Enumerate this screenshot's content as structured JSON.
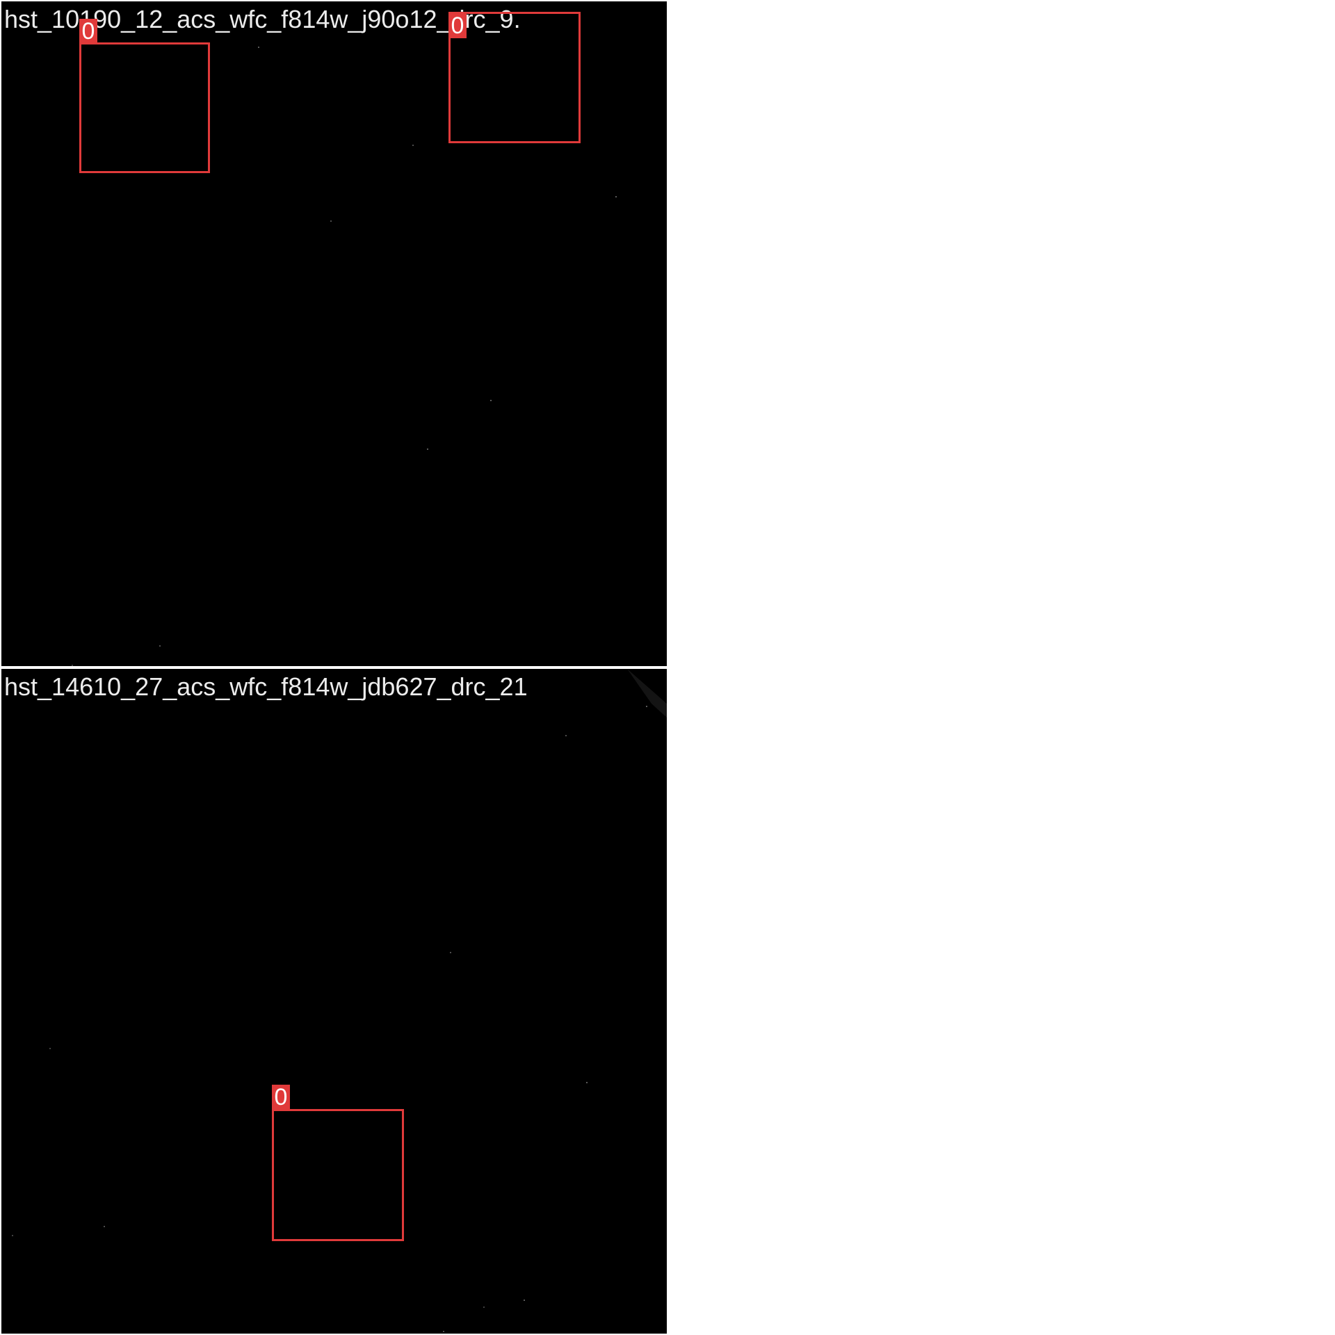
{
  "tiles": [
    {
      "title": "hst_10190_12_acs_wfc_f814w_j90o12_drc_9.",
      "detections": [
        {
          "label": "0"
        },
        {
          "label": "0"
        }
      ]
    },
    {
      "title": "hst_14610_27_acs_wfc_f814w_jdb627_drc_21",
      "detections": [
        {
          "label": "0"
        }
      ]
    }
  ],
  "colors": {
    "background": "#000000",
    "box": "#e03a3a",
    "title_text": "#ececec",
    "separator": "#ffffff"
  }
}
